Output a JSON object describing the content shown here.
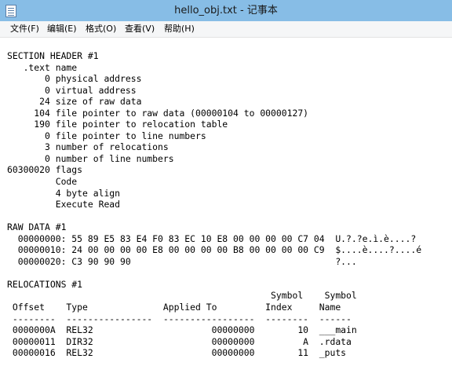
{
  "window": {
    "title": "hello_obj.txt - 记事本"
  },
  "menu": [
    {
      "label": "文件(F)"
    },
    {
      "label": "编辑(E)"
    },
    {
      "label": "格式(O)"
    },
    {
      "label": "查看(V)"
    },
    {
      "label": "帮助(H)"
    }
  ],
  "editor": {
    "lines": [
      "SECTION HEADER #1",
      "   .text name",
      "       0 physical address",
      "       0 virtual address",
      "      24 size of raw data",
      "     104 file pointer to raw data (00000104 to 00000127)",
      "     190 file pointer to relocation table",
      "       0 file pointer to line numbers",
      "       3 number of relocations",
      "       0 number of line numbers",
      "60300020 flags",
      "         Code",
      "         4 byte align",
      "         Execute Read",
      "",
      "RAW DATA #1",
      "  00000000: 55 89 E5 83 E4 F0 83 EC 10 E8 00 00 00 00 C7 04  U.?.?e.ì.è....?",
      "  00000010: 24 00 00 00 00 E8 00 00 00 00 B8 00 00 00 00 C9  $....è....?....é",
      "  00000020: C3 90 90 90                                      ?...",
      "",
      "RELOCATIONS #1",
      "                                                 Symbol    Symbol",
      " Offset    Type              Applied To         Index     Name",
      " --------  ----------------  -----------------  --------  ------",
      " 0000000A  REL32                      00000000        10  ___main",
      " 00000011  DIR32                      00000000         A  .rdata",
      " 00000016  REL32                      00000000        11  _puts"
    ]
  }
}
